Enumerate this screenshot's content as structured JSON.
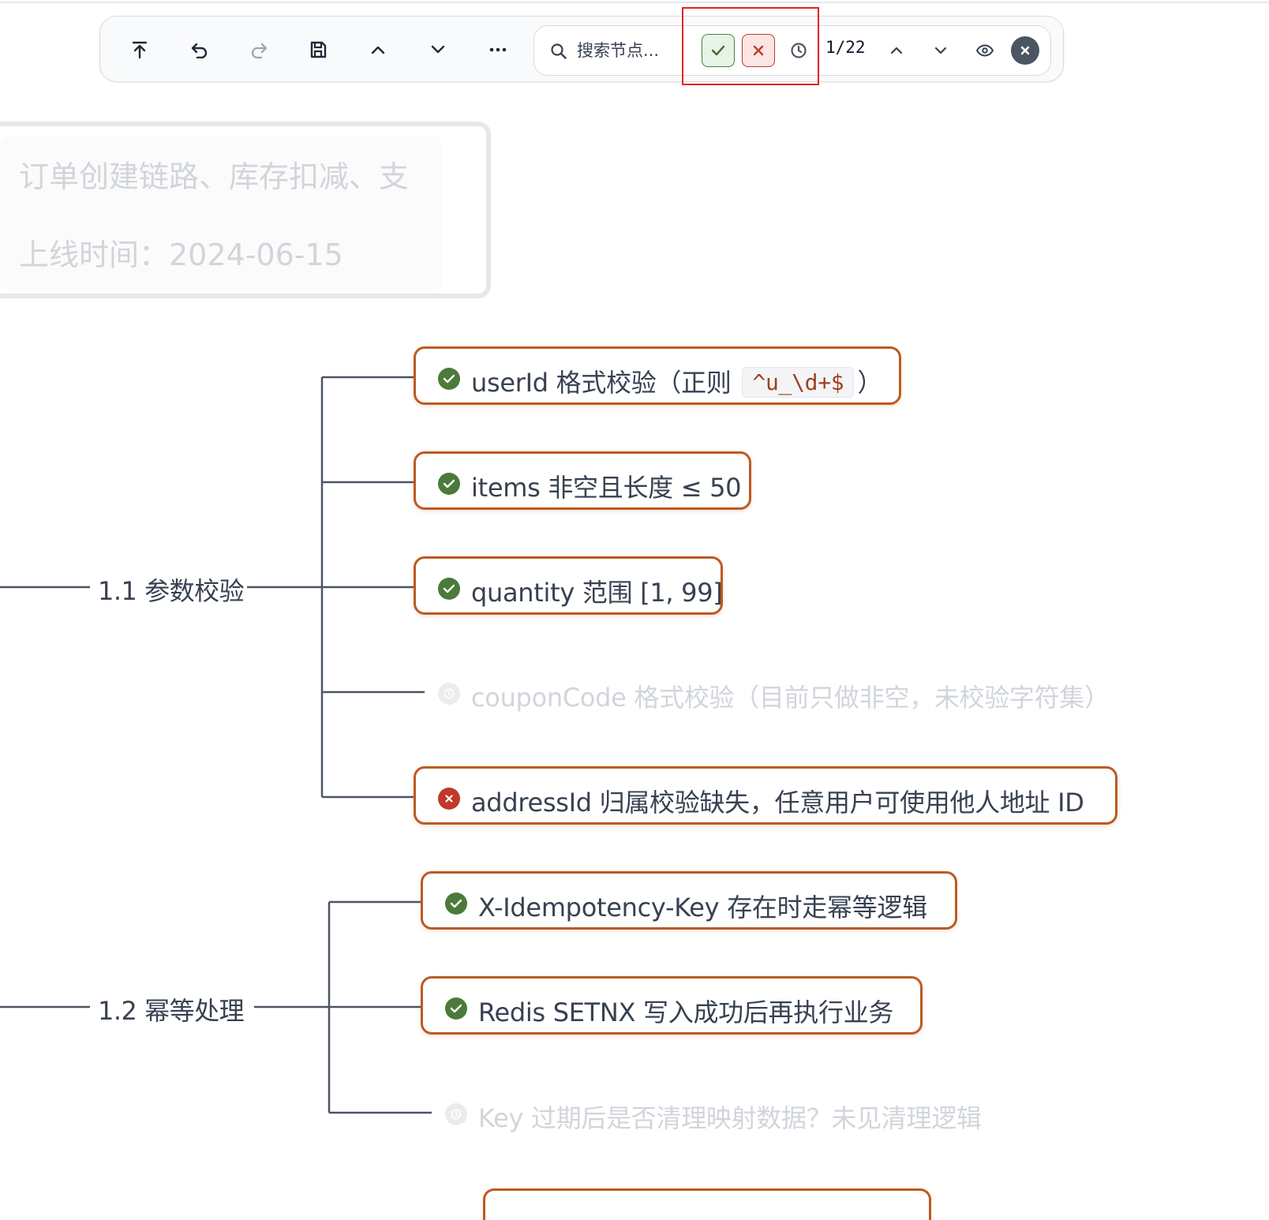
{
  "toolbar": {
    "search_placeholder": "搜索节点...",
    "counter": "1/22"
  },
  "card": {
    "line1": "订单创建链路、库存扣减、支",
    "line2": "上线时间：2024-06-15"
  },
  "branches": [
    {
      "label": "1.1 参数校验",
      "nodes": [
        {
          "status": "ok",
          "text": "userId 格式校验（正则",
          "code": "^u_\\d+$",
          "text_after": "）"
        },
        {
          "status": "ok",
          "text": "items 非空且长度 ≤ 50"
        },
        {
          "status": "ok",
          "text": "quantity 范围 [1, 99]"
        },
        {
          "status": "pending",
          "text": "couponCode 格式校验（目前只做非空，未校验字符集）"
        },
        {
          "status": "fail",
          "text": "addressId 归属校验缺失，任意用户可使用他人地址 ID"
        }
      ]
    },
    {
      "label": "1.2 幂等处理",
      "nodes": [
        {
          "status": "ok",
          "text": "X-Idempotency-Key 存在时走幂等逻辑"
        },
        {
          "status": "ok",
          "text": "Redis SETNX 写入成功后再执行业务"
        },
        {
          "status": "pending",
          "text": "Key 过期后是否清理映射数据？未见清理逻辑"
        }
      ]
    }
  ],
  "colors": {
    "node_border": "#bd5a22",
    "ok": "#4b7a3b",
    "fail": "#c0392b",
    "highlight": "#e02424"
  },
  "icons": {
    "toolbar": [
      "scroll-to-top-icon",
      "undo-icon",
      "redo-icon",
      "save-icon",
      "chevron-up-icon",
      "chevron-down-icon",
      "more-icon"
    ],
    "search": [
      "search-icon",
      "check-icon",
      "x-icon",
      "clock-icon",
      "chevron-up-icon",
      "chevron-down-icon",
      "eye-icon",
      "close-icon"
    ]
  }
}
